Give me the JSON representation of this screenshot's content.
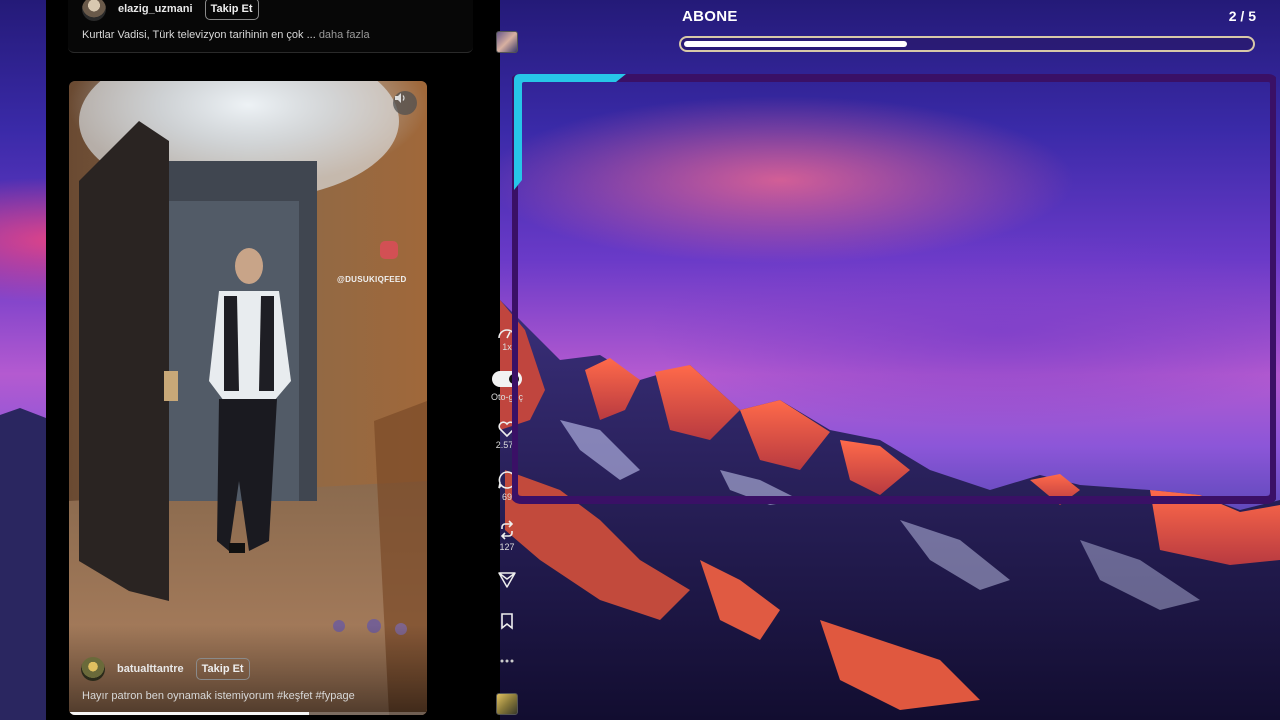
{
  "top_post": {
    "username": "elazig_uzmani",
    "follow_label": "Takip Et",
    "caption": "Kurtlar Vadisi, Türk televizyon tarihinin en çok ...",
    "more_label": "daha fazla"
  },
  "video_post": {
    "watermark": "@DUSUKIQFEED",
    "username": "batualttantre",
    "follow_label": "Takip Et",
    "caption": "Hayır patron ben oynamak istemiyorum #keşfet #fypage",
    "playback_progress": 0.67
  },
  "side_actions": {
    "more_top_icon": "more-horizontal-icon",
    "speed_label": "1x",
    "autoplay_label": "Oto-geç",
    "autoplay_on": true,
    "likes": "2.573",
    "comments": "69",
    "reposts": "127"
  },
  "overlay": {
    "title": "ABONE",
    "counter": "2 / 5",
    "progress": 0.4,
    "accent_color": "#27c6e8",
    "frame_color": "#3a1066"
  }
}
